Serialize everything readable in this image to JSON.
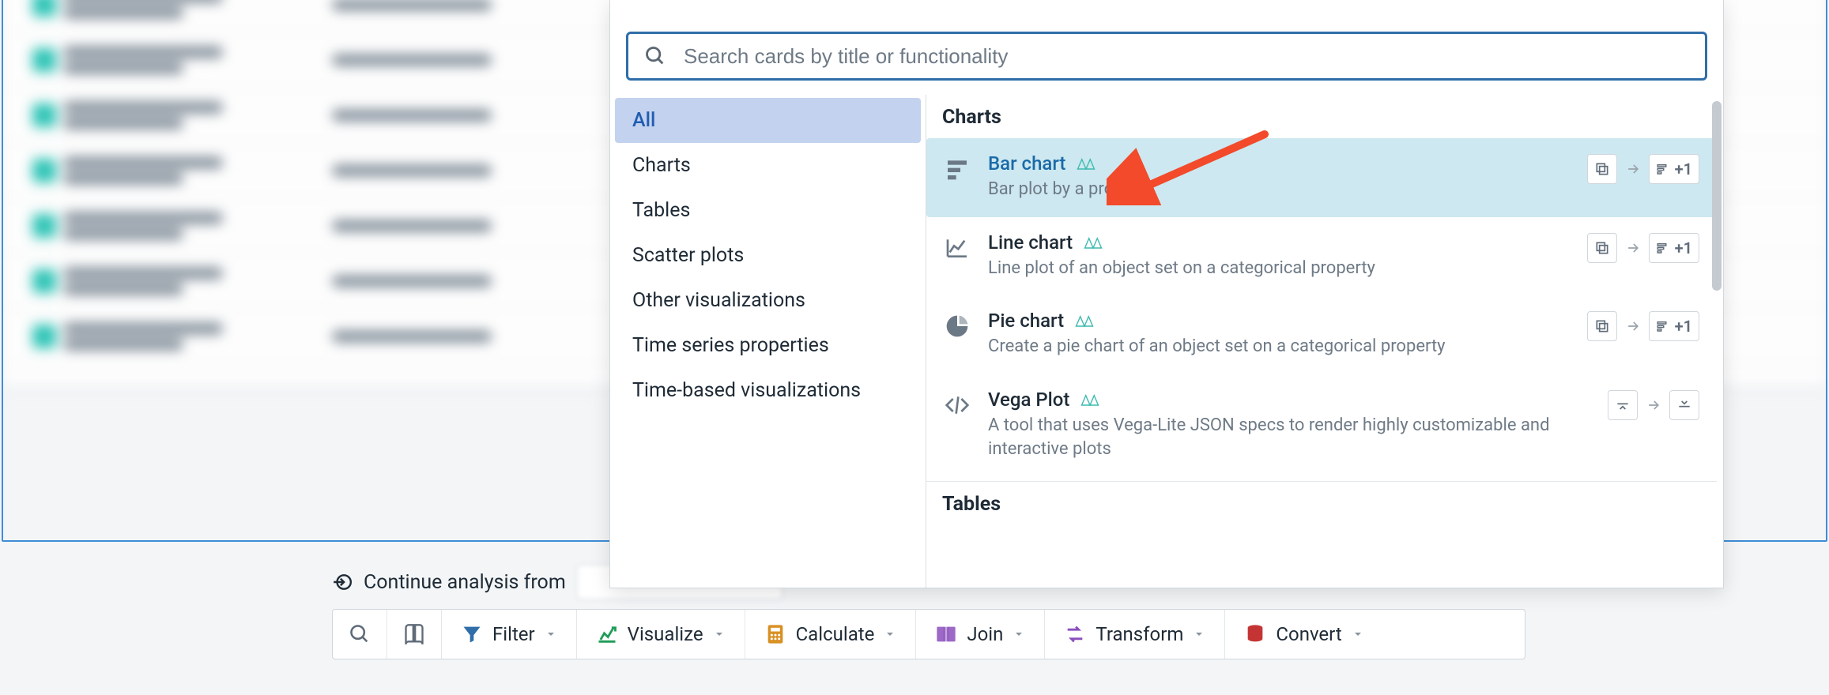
{
  "search": {
    "placeholder": "Search cards by title or functionality"
  },
  "categories": [
    "All",
    "Charts",
    "Tables",
    "Scatter plots",
    "Other visualizations",
    "Time series properties",
    "Time-based visualizations"
  ],
  "selected_category": "All",
  "sections": [
    {
      "title": "Charts",
      "cards": [
        {
          "title": "Bar chart",
          "desc": "Bar plot by a property",
          "badge": "+1",
          "hovered": true
        },
        {
          "title": "Line chart",
          "desc": "Line plot of an object set on a categorical property",
          "badge": "+1"
        },
        {
          "title": "Pie chart",
          "desc": "Create a pie chart of an object set on a categorical property",
          "badge": "+1"
        },
        {
          "title": "Vega Plot",
          "desc": "A tool that uses Vega-Lite JSON specs to render highly customizable and interactive plots",
          "badge": ""
        }
      ]
    },
    {
      "title": "Tables",
      "cards": []
    }
  ],
  "continue_label": "Continue analysis from",
  "toolbar": {
    "filter": "Filter",
    "visualize": "Visualize",
    "calculate": "Calculate",
    "join": "Join",
    "transform": "Transform",
    "convert": "Convert"
  }
}
